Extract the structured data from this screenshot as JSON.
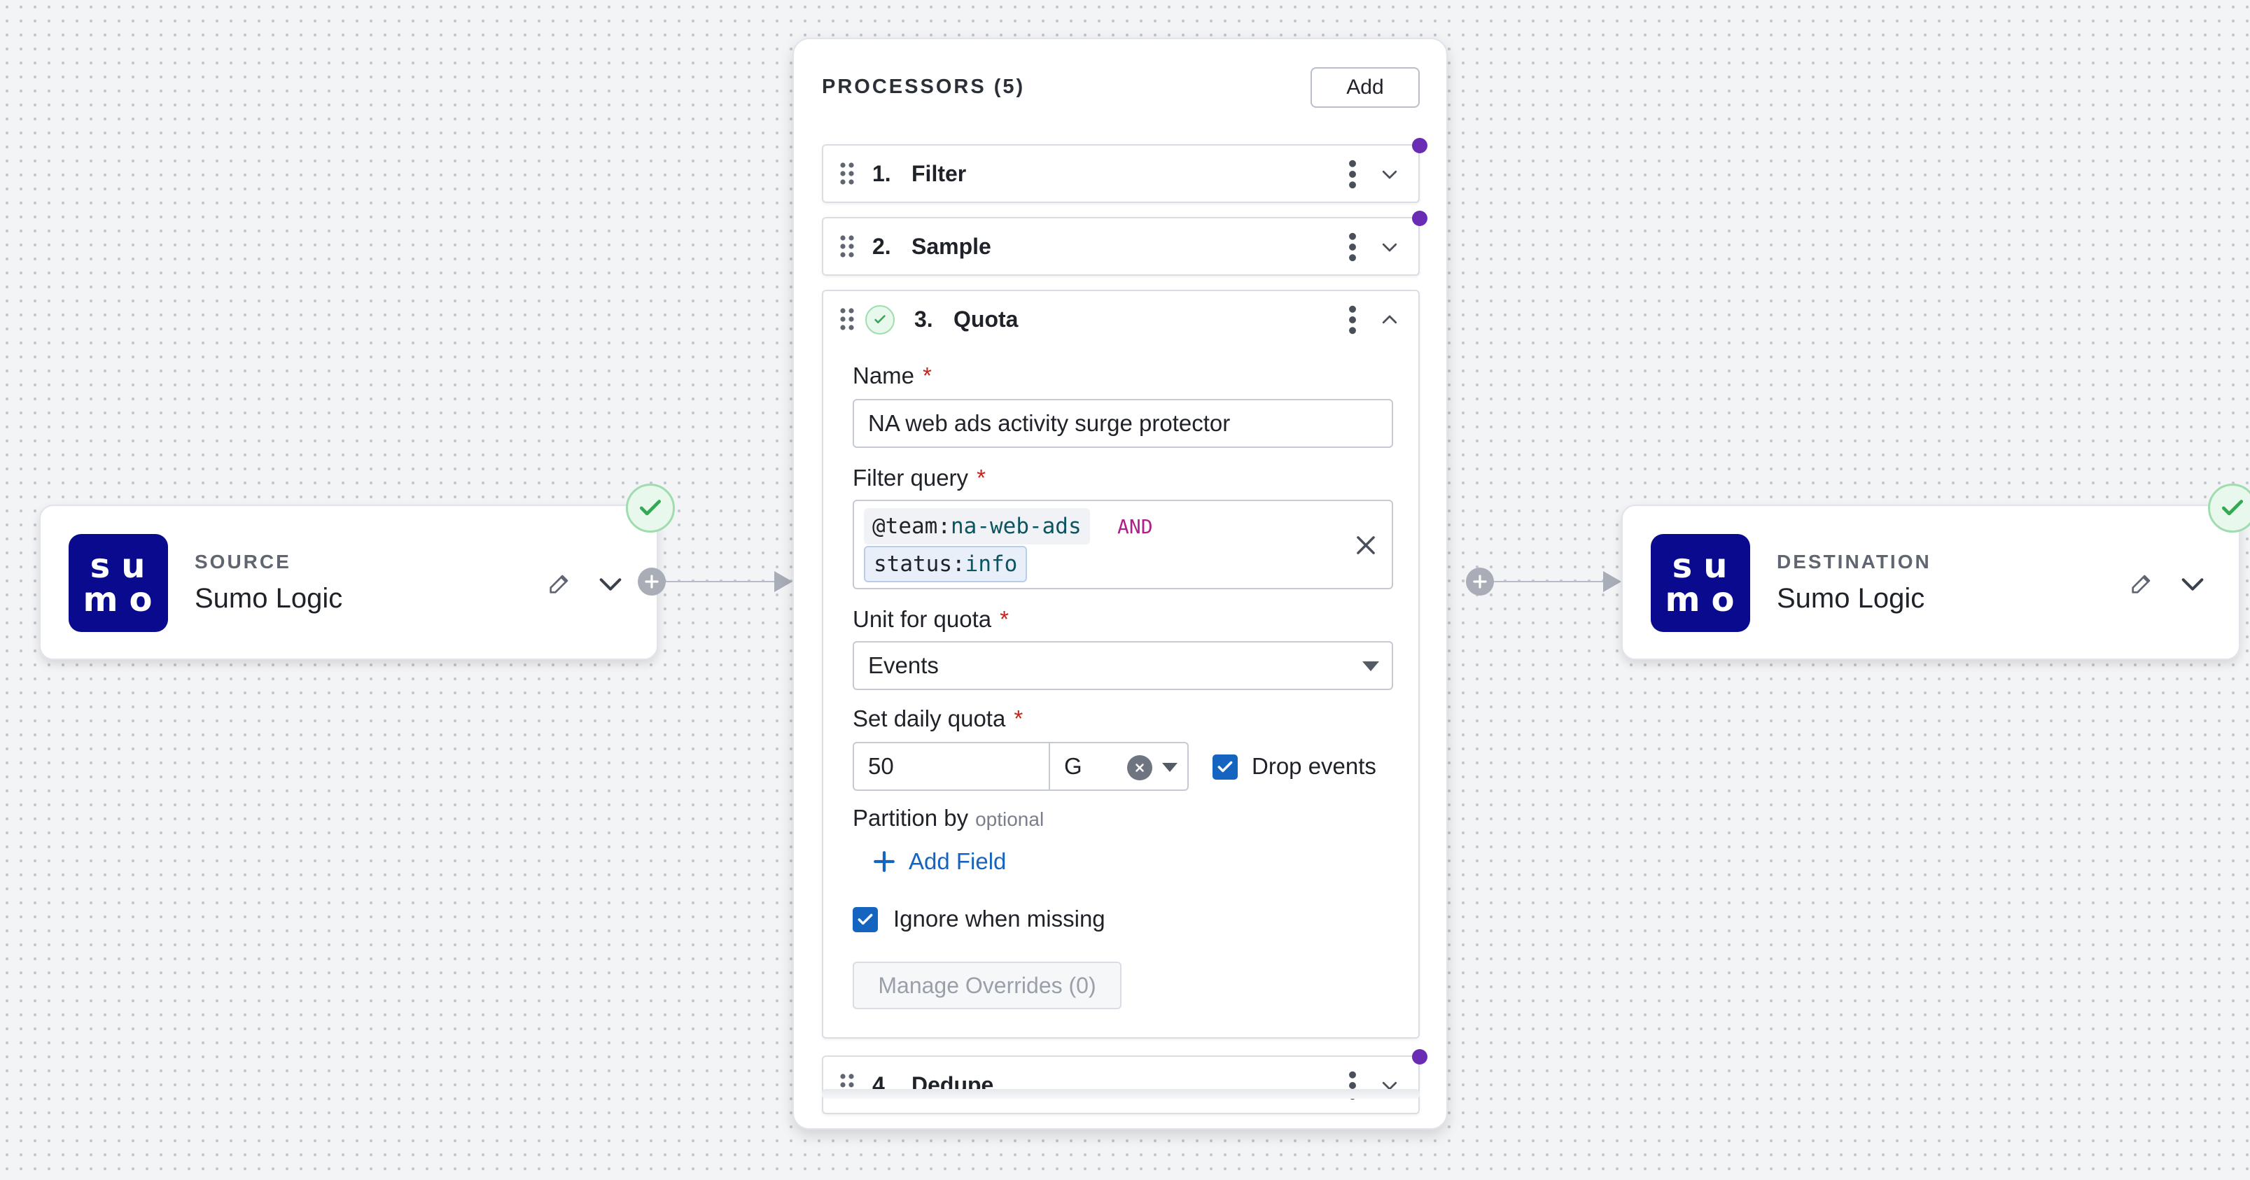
{
  "source_node": {
    "logo_line1": "su",
    "logo_line2": "mo",
    "kind": "SOURCE",
    "name": "Sumo Logic"
  },
  "destination_node": {
    "logo_line1": "su",
    "logo_line2": "mo",
    "kind": "DESTINATION",
    "name": "Sumo Logic"
  },
  "processors": {
    "title": "PROCESSORS (5)",
    "add_label": "Add",
    "items": [
      {
        "number": "1.",
        "label": "Filter"
      },
      {
        "number": "2.",
        "label": "Sample"
      },
      {
        "number": "3.",
        "label": "Quota"
      },
      {
        "number": "4.",
        "label": "Dedupe"
      }
    ]
  },
  "quota_form": {
    "name_label": "Name",
    "name_value": "NA web ads activity surge protector",
    "filter_label": "Filter query",
    "filter_tokens": [
      {
        "key": "@team",
        "colon": ":",
        "value": "na-web-ads"
      },
      {
        "key": "status",
        "colon": ":",
        "value": "info"
      }
    ],
    "filter_operator": "AND",
    "unit_label": "Unit for quota",
    "unit_value": "Events",
    "daily_label": "Set daily quota",
    "daily_value": "50",
    "daily_unit": "G",
    "drop_events_label": "Drop events",
    "drop_events_checked": true,
    "partition_label": "Partition by",
    "partition_optional": "optional",
    "add_field_label": "Add Field",
    "ignore_missing_label": "Ignore when missing",
    "ignore_missing_checked": true,
    "manage_overrides_label": "Manage Overrides (0)",
    "required_marker": "*"
  },
  "colors": {
    "accent": "#1565c0",
    "logo_bg": "#0a0a8f",
    "success": "#34a853",
    "status_dot": "#6a2bb5",
    "required": "#c7231d",
    "operator": "#b11d8a"
  },
  "icons": {
    "edit": "pencil-icon",
    "expand": "chevron-down-icon",
    "collapse": "chevron-up-icon",
    "menu": "kebab-menu-icon",
    "drag": "drag-handle-icon",
    "status": "check-circle-icon",
    "add_step": "plus-circle-icon"
  }
}
